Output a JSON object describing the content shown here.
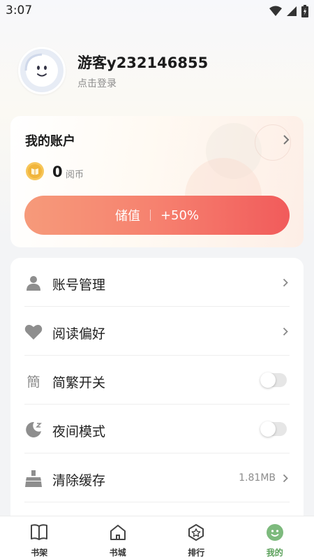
{
  "status_bar": {
    "time": "3:07"
  },
  "profile": {
    "username": "游客y232146855",
    "login_hint": "点击登录"
  },
  "account": {
    "title": "我的账户",
    "coins": "0",
    "coin_unit": "阅币",
    "recharge_label": "储值",
    "recharge_bonus": "+50%"
  },
  "settings": {
    "items": [
      {
        "label": "账号管理",
        "icon": "person-icon",
        "control": "arrow"
      },
      {
        "label": "阅读偏好",
        "icon": "heart-icon",
        "control": "arrow"
      },
      {
        "label": "简繁开关",
        "icon": "traditional-char-icon",
        "icon_text": "簡",
        "control": "toggle",
        "toggle_on": false
      },
      {
        "label": "夜间模式",
        "icon": "moon-icon",
        "control": "toggle",
        "toggle_on": false
      },
      {
        "label": "清除缓存",
        "icon": "broom-icon",
        "control": "arrow",
        "value": "1.81MB"
      }
    ]
  },
  "bottom_nav": {
    "items": [
      {
        "label": "书架",
        "icon": "bookshelf-icon"
      },
      {
        "label": "书城",
        "icon": "home-icon"
      },
      {
        "label": "排行",
        "icon": "ranking-icon"
      },
      {
        "label": "我的",
        "icon": "profile-face-icon",
        "active": true
      }
    ]
  },
  "colors": {
    "accent_green": "#5aa05a",
    "recharge_start": "#f69a7a",
    "recharge_end": "#f15b5b",
    "coin_gold": "#f1b53b"
  }
}
